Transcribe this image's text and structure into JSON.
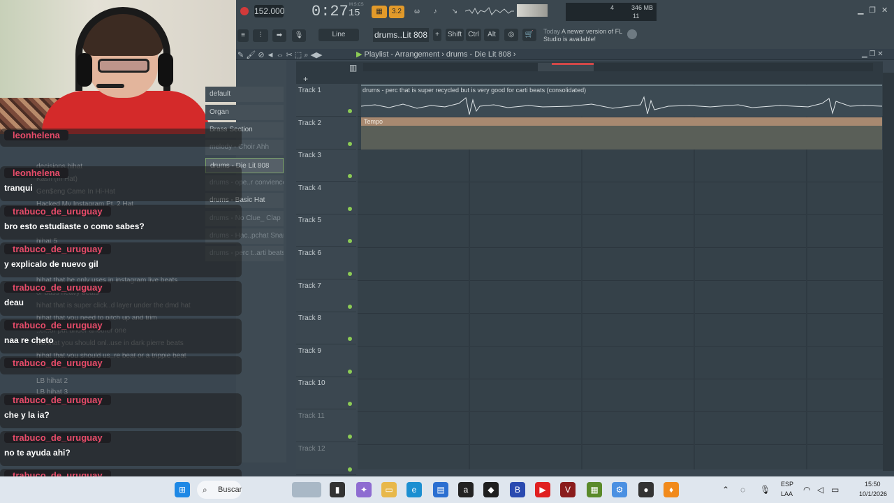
{
  "fl": {
    "bpm": "152.000",
    "time": "0:27",
    "time_small": "15",
    "time_label": "M:S:CS",
    "pattern_buttons": [
      "3.2"
    ],
    "cpu_num": "4",
    "ram": "346 MB",
    "voices": "11",
    "snap": "Line",
    "pattern_selector": "drums..Lit 808",
    "keys": [
      "Shift",
      "Ctrl",
      "Alt"
    ],
    "news_date": "Today",
    "news_text": "A newer version of FL Studio is available!"
  },
  "playlist": {
    "title": "Playlist - Arrangement",
    "breadcrumb": "drums - Die Lit 808",
    "tracks": [
      "Track 1",
      "Track 2",
      "Track 3",
      "Track 4",
      "Track 5",
      "Track 6",
      "Track 7",
      "Track 8",
      "Track 9",
      "Track 10",
      "Track 11",
      "Track 12"
    ],
    "audio_clip": "drums - perc that is super recycled but is very good for carti beats (consolidated)",
    "auto_clip": "Tempo"
  },
  "patterns": [
    {
      "label": "default"
    },
    {
      "label": "Organ"
    },
    {
      "label": "Brass Section"
    },
    {
      "label": "melody - Choir Ahh"
    },
    {
      "label": "drums - Die Lit 808"
    },
    {
      "label": "drums - ope..r convience"
    },
    {
      "label": "drums - Basic Hat"
    },
    {
      "label": "drums - No Clue_ Clap"
    },
    {
      "label": "drums - Hac..pchat Snare"
    },
    {
      "label": "drums - perc t..arti beats"
    }
  ],
  "chat": [
    {
      "user": "leonhelena",
      "msg": ""
    },
    {
      "user": "leonhelena",
      "msg": "tranqui"
    },
    {
      "user": "trabuco_de_uruguay",
      "msg": "bro esto estudiaste o como sabes?"
    },
    {
      "user": "trabuco_de_uruguay",
      "msg": "y explicalo de nuevo gil"
    },
    {
      "user": "trabuco_de_uruguay",
      "msg": "deau"
    },
    {
      "user": "trabuco_de_uruguay",
      "msg": "naa re cheto"
    },
    {
      "user": "trabuco_de_uruguay",
      "msg": ""
    },
    {
      "user": "trabuco_de_uruguay",
      "msg": "che y la ia?"
    },
    {
      "user": "trabuco_de_uruguay",
      "msg": "no te ayuda ahi?"
    },
    {
      "user": "trabuco_de_uruguay",
      "msg": ""
    }
  ],
  "ghost_text": [
    "decisions hihat",
    "Kash (III Hat)",
    "Gen$eng Came In Hi-Hat",
    "Hacked My Instagram Pt. 2 Hat",
    "hihat 5",
    "hihat that he only uses in instagram live beats",
    "or bass heavy beats",
    "hihat that is super click..d layer under the dmd hat",
    "hihat that you need to pitch up and trim",
    "..el..or put under another one",
    "hat that you should onl..use in dark pierre beats",
    "hihat that you should us..re beat or a trippie beat",
    "LB hihat 2",
    "LB hihat 3"
  ],
  "taskbar": {
    "search": "Buscar",
    "lang1": "ESP",
    "lang2": "LAA",
    "clock": "15:50",
    "date": "10/1/2026"
  }
}
